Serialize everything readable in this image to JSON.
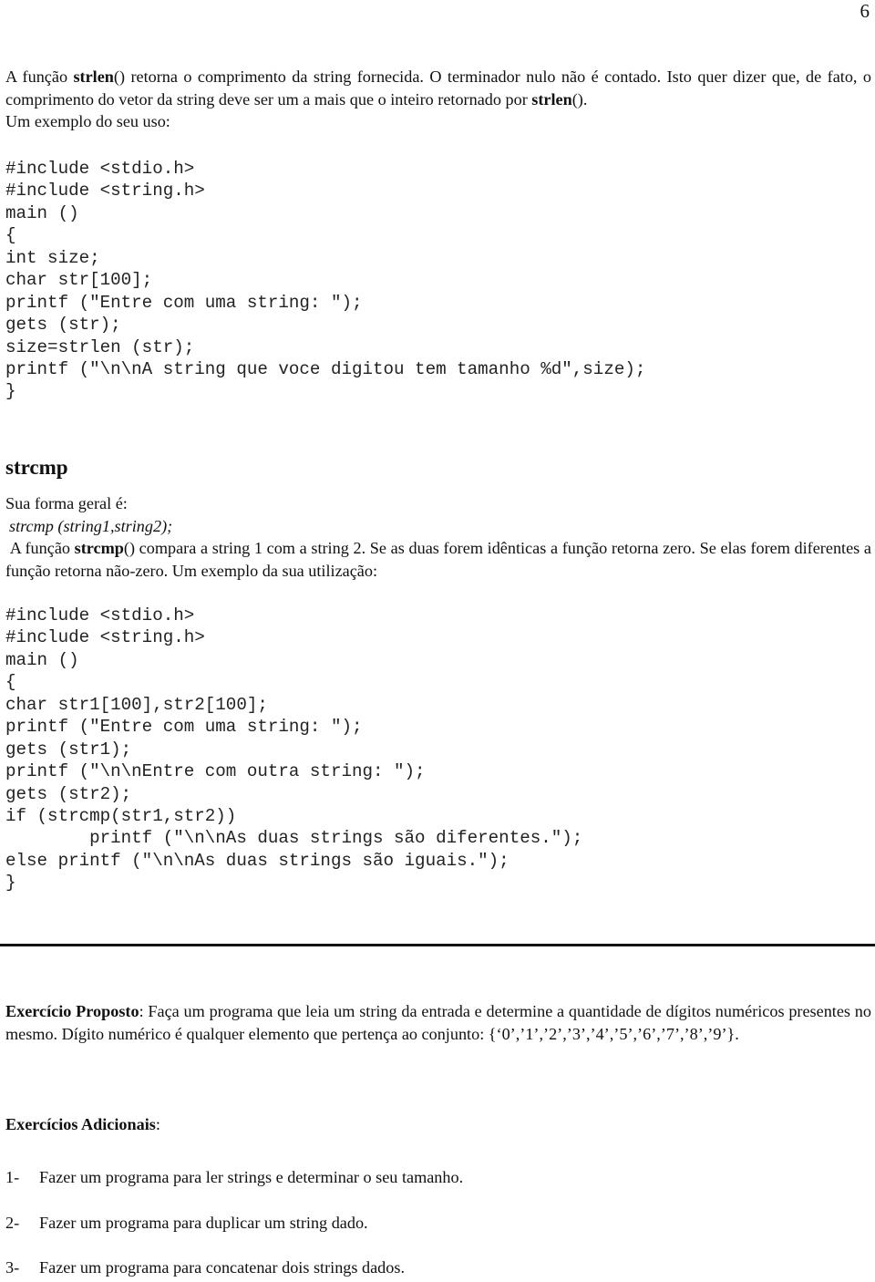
{
  "page_number": "6",
  "strlen_section": {
    "para_prefix": "A função ",
    "para_bold1": "strlen",
    "para_mid": "() retorna o comprimento da string fornecida. O terminador nulo não é contado. Isto quer dizer que, de fato, o comprimento do vetor da string deve ser um a mais que o inteiro retornado por ",
    "para_bold2": "strlen",
    "para_suffix": "().",
    "para_line3": "Um exemplo do seu uso:",
    "code": [
      "#include <stdio.h>",
      "#include <string.h>",
      "main ()",
      "{",
      "int size;",
      "char str[100];",
      "printf (\"Entre com uma string: \");",
      "gets (str);",
      "size=strlen (str);",
      "printf (\"\\n\\nA string que voce digitou tem tamanho %d\",size);",
      "}"
    ]
  },
  "strcmp_section": {
    "heading": "strcmp",
    "general_form_label": "Sua forma geral é:",
    "general_form": "strcmp (string1,string2);",
    "para_prefix": "A função ",
    "para_bold": "strcmp",
    "para_suffix": "() compara a string 1 com a string 2. Se as duas forem idênticas a função retorna zero. Se elas forem diferentes a função retorna não-zero. Um exemplo da sua utilização:",
    "code": [
      "#include <stdio.h>",
      "#include <string.h>",
      "main ()",
      "{",
      "char str1[100],str2[100];",
      "printf (\"Entre com uma string: \");",
      "gets (str1);",
      "printf (\"\\n\\nEntre com outra string: \");",
      "gets (str2);",
      "if (strcmp(str1,str2))",
      "        printf (\"\\n\\nAs duas strings são diferentes.\");",
      "else printf (\"\\n\\nAs duas strings são iguais.\");",
      "}"
    ]
  },
  "exercise_proposed": {
    "label": "Exercício Proposto",
    "text": ": Faça um programa que leia um string da entrada e determine a quantidade de dígitos numéricos presentes no mesmo. Dígito numérico é qualquer elemento que pertença ao conjunto: {‘0’,’1’,’2’,’3’,’4’,’5’,’6’,’7’,’8’,’9’}."
  },
  "additional_exercises": {
    "label": "Exercícios Adicionais",
    "colon": ":",
    "items": [
      {
        "num": "1-",
        "text": "Fazer um programa para ler strings e determinar o seu tamanho."
      },
      {
        "num": "2-",
        "text": "Fazer um programa para duplicar um string dado."
      },
      {
        "num": "3-",
        "text": "Fazer um programa para concatenar dois strings dados."
      }
    ]
  }
}
